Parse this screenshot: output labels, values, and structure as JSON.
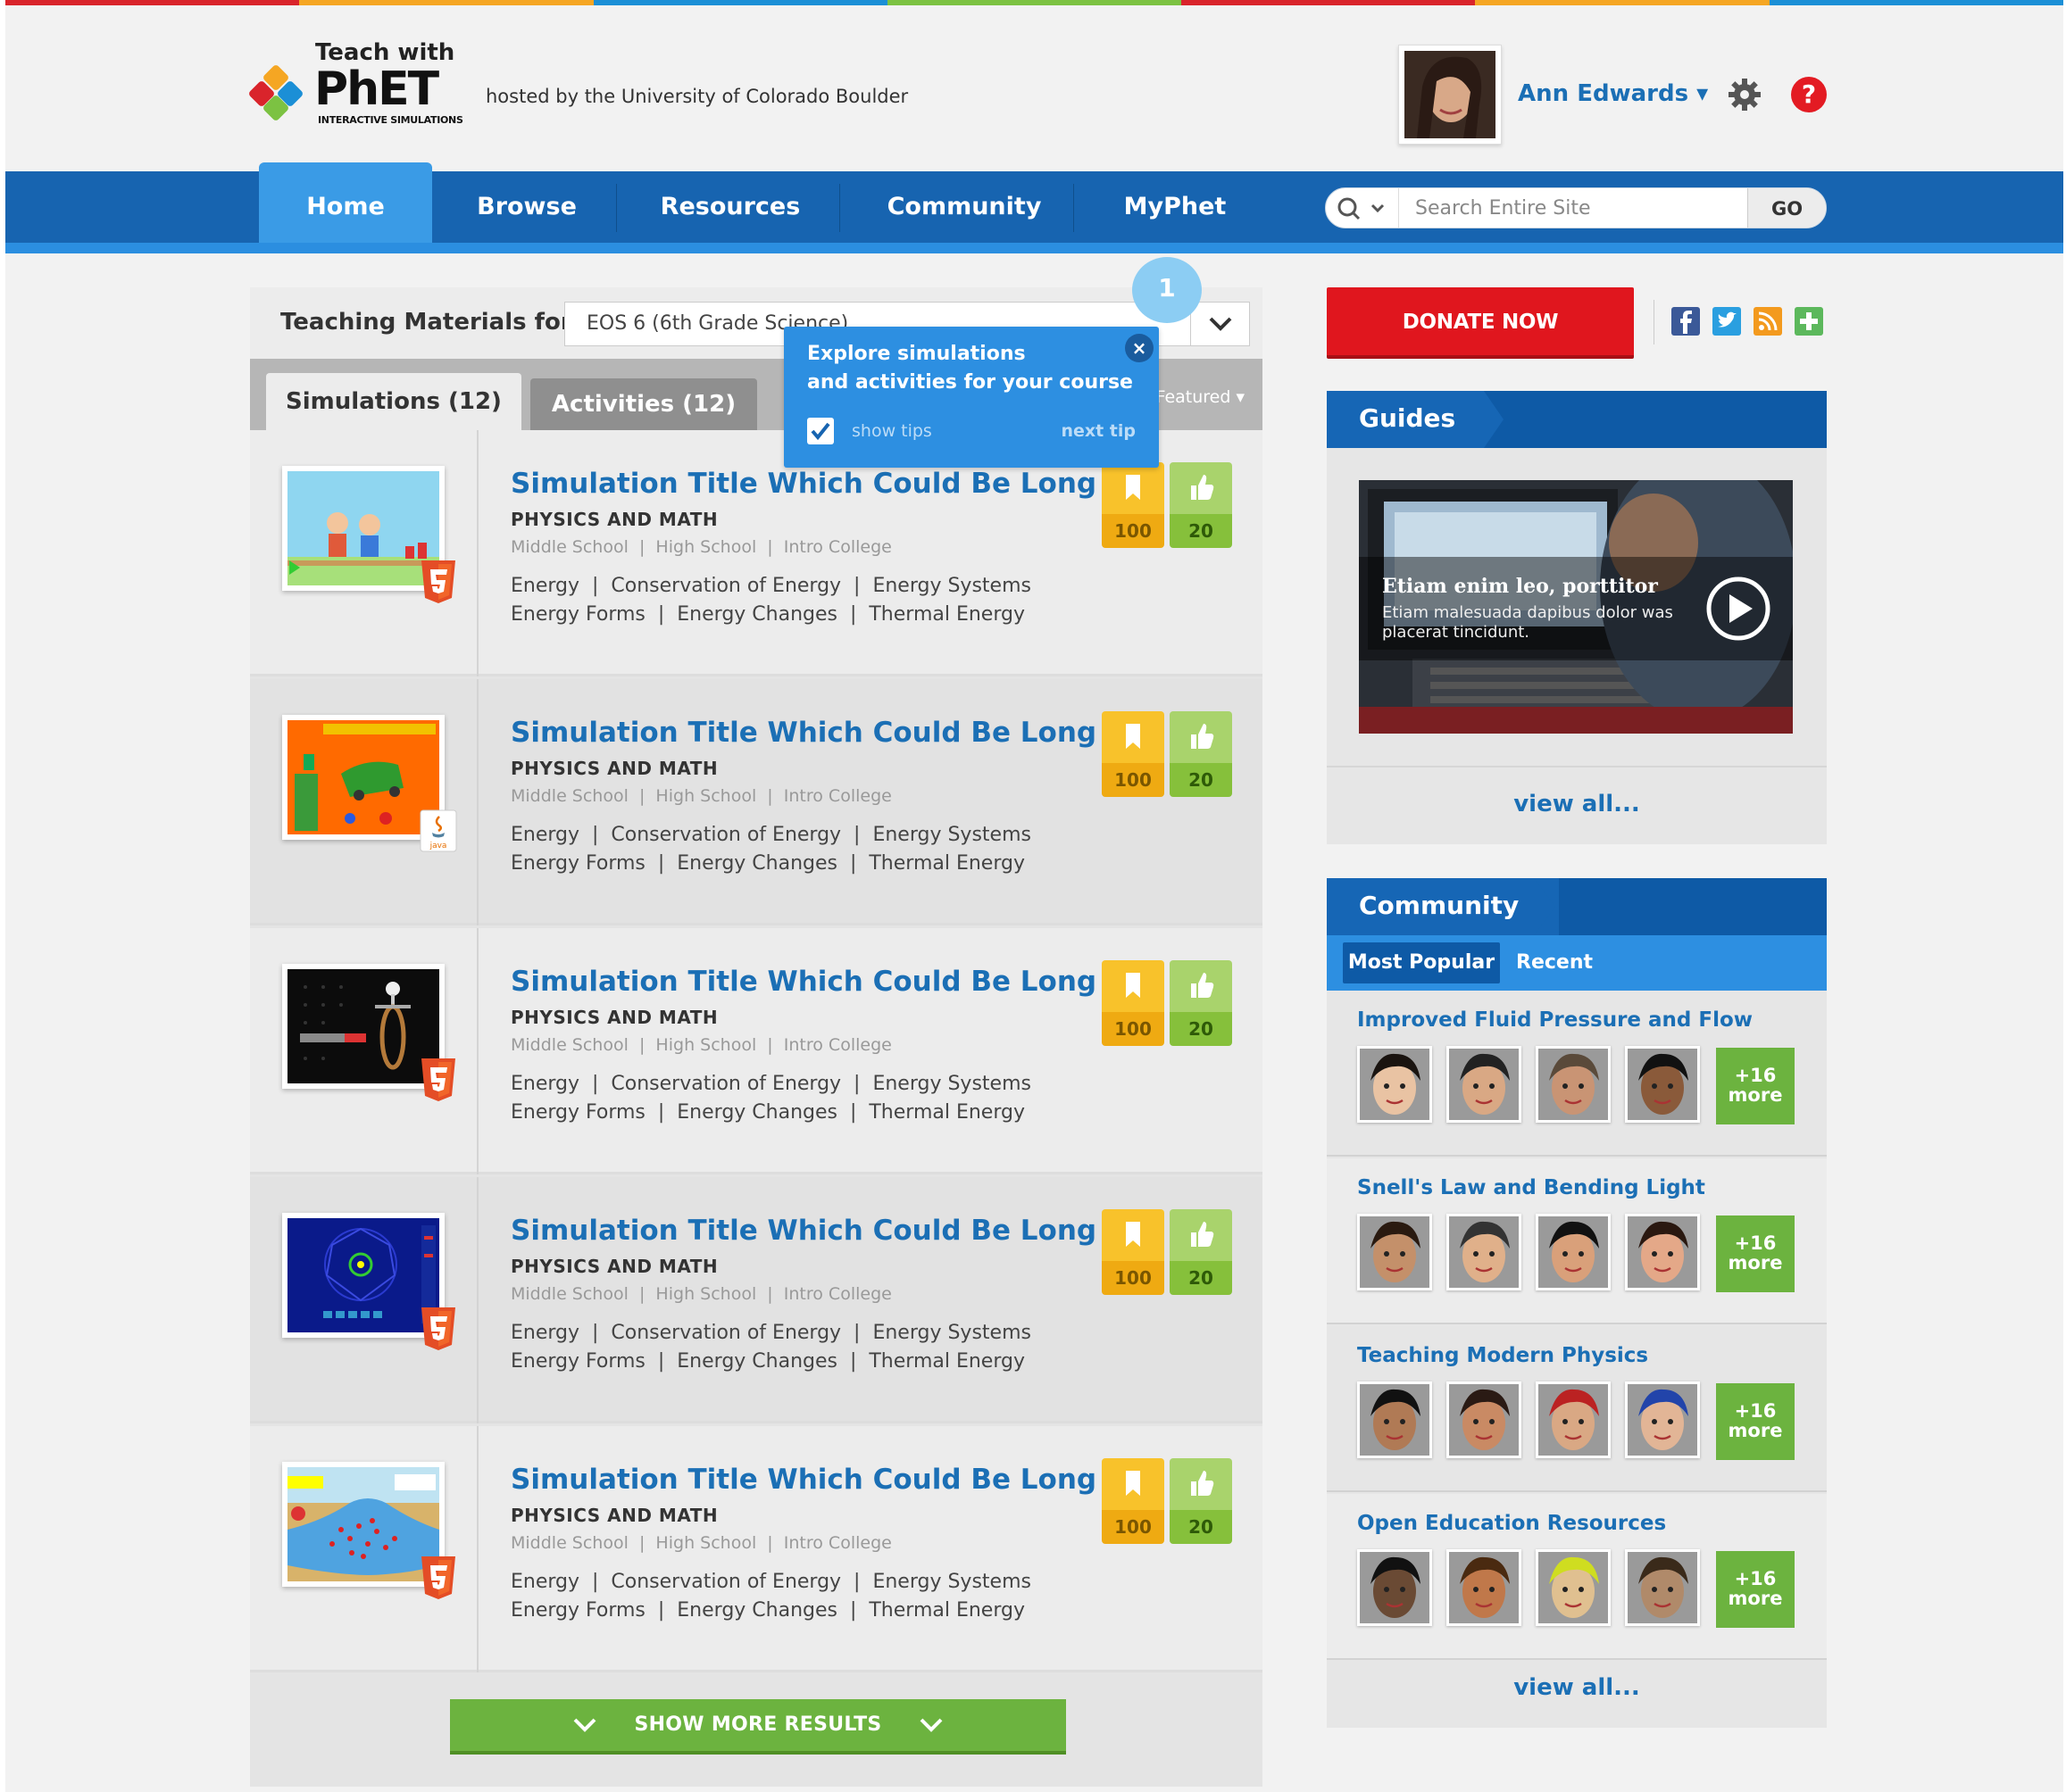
{
  "colors": {
    "stripe": [
      "#d9242b",
      "#f5a623",
      "#1b8fd6",
      "#7cc242",
      "#d9242b",
      "#f5a623",
      "#1b8fd6"
    ],
    "nav": "#1764b0",
    "nav_active": "#3a9be6",
    "link": "#1b6fb5",
    "donate": "#e0161e",
    "green": "#6cb33f",
    "fav": "#f8c22b"
  },
  "header": {
    "teach_with": "Teach with",
    "logo_text": "PhET",
    "logo_sub": "INTERACTIVE SIMULATIONS",
    "hosted_by": "hosted by the University of Colorado Boulder",
    "user_name": "Ann Edwards ▾",
    "help": "?"
  },
  "nav": {
    "items": [
      "Home",
      "Browse",
      "Resources",
      "Community",
      "MyPhet"
    ],
    "search_placeholder": "Search Entire Site",
    "go": "GO"
  },
  "teaching": {
    "label": "Teaching Materials for",
    "course": "EOS 6 (6th Grade Science)",
    "tab_sims": "Simulations (12)",
    "tab_acts": "Activities (12)",
    "sort": "Featured ▾"
  },
  "tooltip": {
    "number": "1",
    "line1": "Explore simulations",
    "line2": "and activities for your course",
    "show_tips": "show tips",
    "next_tip": "next tip"
  },
  "simulations": [
    {
      "title": "Simulation Title Which Could Be Long",
      "subject": "PHYSICS AND MATH",
      "levels": "Middle School  |  High School  |  Intro College",
      "tags1": "Energy  |  Conservation of Energy  |  Energy Systems",
      "tags2": "Energy Forms  |  Energy Changes  |  Thermal Energy",
      "favorites": "100",
      "likes": "20",
      "badge": "html5-icon"
    },
    {
      "title": "Simulation Title Which Could Be Long",
      "subject": "PHYSICS AND MATH",
      "levels": "Middle School  |  High School  |  Intro College",
      "tags1": "Energy  |  Conservation of Energy  |  Energy Systems",
      "tags2": "Energy Forms  |  Energy Changes  |  Thermal Energy",
      "favorites": "100",
      "likes": "20",
      "badge": "java-icon"
    },
    {
      "title": "Simulation Title Which Could Be Long",
      "subject": "PHYSICS AND MATH",
      "levels": "Middle School  |  High School  |  Intro College",
      "tags1": "Energy  |  Conservation of Energy  |  Energy Systems",
      "tags2": "Energy Forms  |  Energy Changes  |  Thermal Energy",
      "favorites": "100",
      "likes": "20",
      "badge": "html5-icon"
    },
    {
      "title": "Simulation Title Which Could Be Long",
      "subject": "PHYSICS AND MATH",
      "levels": "Middle School  |  High School  |  Intro College",
      "tags1": "Energy  |  Conservation of Energy  |  Energy Systems",
      "tags2": "Energy Forms  |  Energy Changes  |  Thermal Energy",
      "favorites": "100",
      "likes": "20",
      "badge": "html5-icon"
    },
    {
      "title": "Simulation Title Which Could Be Long",
      "subject": "PHYSICS AND MATH",
      "levels": "Middle School  |  High School  |  Intro College",
      "tags1": "Energy  |  Conservation of Energy  |  Energy Systems",
      "tags2": "Energy Forms  |  Energy Changes  |  Thermal Energy",
      "favorites": "100",
      "likes": "20",
      "badge": "html5-icon"
    }
  ],
  "show_more": "SHOW MORE RESULTS",
  "sidebar": {
    "donate": "DONATE NOW",
    "social": [
      "facebook-icon",
      "twitter-icon",
      "rss-icon",
      "share-icon"
    ],
    "guides": {
      "title": "Guides",
      "video_title": "Etiam enim leo, porttitor",
      "video_desc": "Etiam malesuada dapibus dolor was placerat tincidunt.",
      "view_all": "view all..."
    },
    "community": {
      "title": "Community",
      "tab_popular": "Most Popular",
      "tab_recent": "Recent",
      "groups": [
        {
          "title": "Improved Fluid Pressure and Flow",
          "more": "+16 more"
        },
        {
          "title": "Snell's Law and Bending Light",
          "more": "+16 more"
        },
        {
          "title": "Teaching Modern Physics",
          "more": "+16 more"
        },
        {
          "title": "Open Education Resources",
          "more": "+16 more"
        }
      ],
      "view_all": "view all..."
    }
  }
}
